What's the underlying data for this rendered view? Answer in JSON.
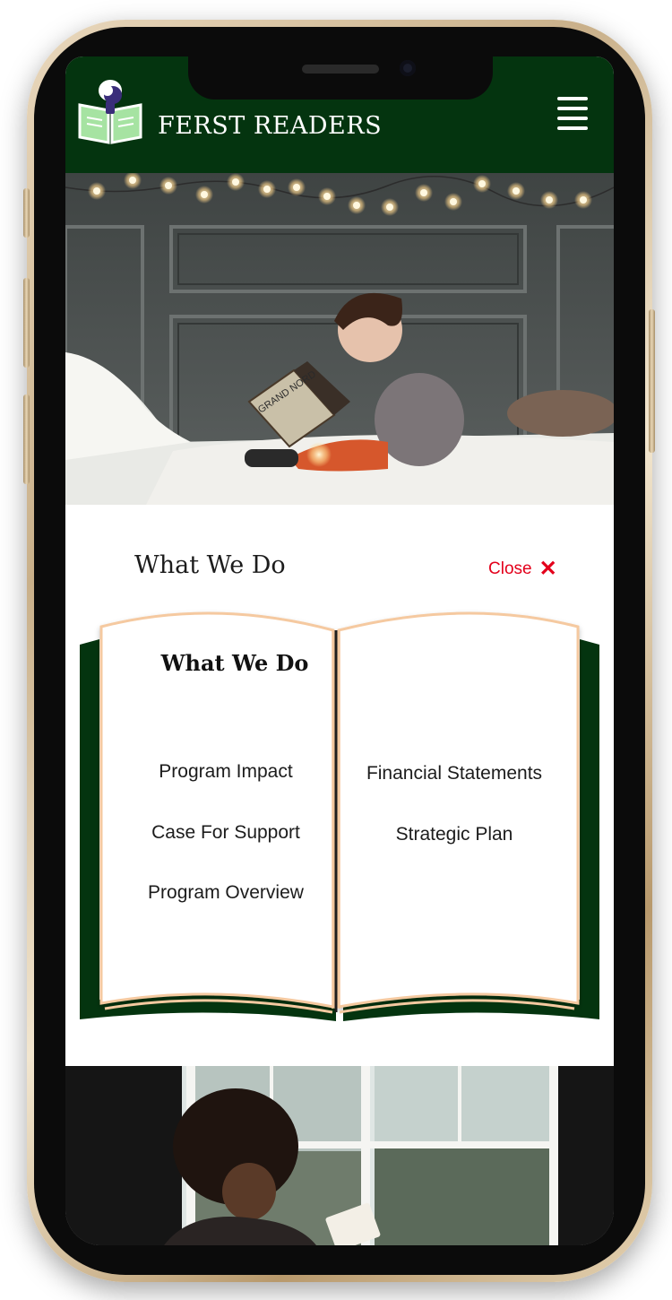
{
  "header": {
    "brand": "FERST READERS"
  },
  "menu": {
    "title": "What We Do",
    "close_label": "Close",
    "book": {
      "heading": "What We Do",
      "left_items": [
        "Program Impact",
        "Case For Support",
        "Program Overview"
      ],
      "right_items": [
        "Financial Statements",
        "Strategic Plan"
      ]
    }
  },
  "colors": {
    "header_bg": "#04340f",
    "book_cover": "#04340f",
    "page_edge": "#f5c9a0",
    "close_red": "#e3001b"
  },
  "icons": [
    "book-reader-logo-icon",
    "hamburger-menu-icon",
    "close-x-icon"
  ]
}
